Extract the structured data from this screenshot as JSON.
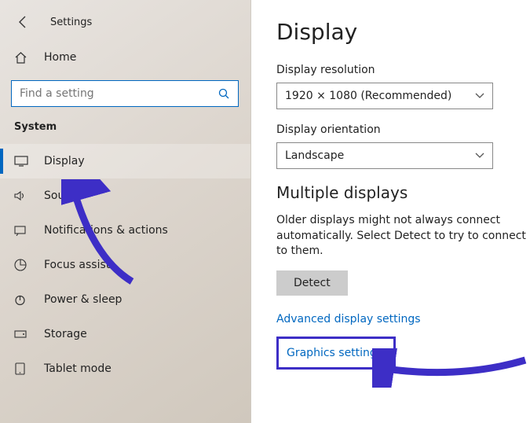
{
  "header": {
    "app_title": "Settings"
  },
  "home": {
    "label": "Home"
  },
  "search": {
    "placeholder": "Find a setting"
  },
  "section": {
    "title": "System"
  },
  "nav": {
    "items": [
      {
        "label": "Display"
      },
      {
        "label": "Sound"
      },
      {
        "label": "Notifications & actions"
      },
      {
        "label": "Focus assist"
      },
      {
        "label": "Power & sleep"
      },
      {
        "label": "Storage"
      },
      {
        "label": "Tablet mode"
      }
    ]
  },
  "main": {
    "title": "Display",
    "resolution_label": "Display resolution",
    "resolution_value": "1920 × 1080 (Recommended)",
    "orientation_label": "Display orientation",
    "orientation_value": "Landscape",
    "multi_heading": "Multiple displays",
    "multi_text": "Older displays might not always connect automatically. Select Detect to try to connect to them.",
    "detect_label": "Detect",
    "link_advanced": "Advanced display settings",
    "link_graphics": "Graphics settings"
  },
  "colors": {
    "accent": "#0067c0",
    "annotation": "#3d2ec6"
  }
}
